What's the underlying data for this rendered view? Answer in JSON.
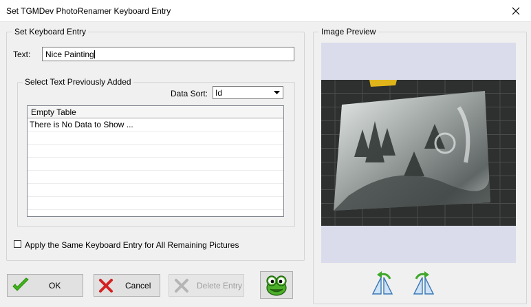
{
  "window": {
    "title": "Set TGMDev PhotoRenamer Keyboard Entry",
    "close_icon": "close-icon"
  },
  "entry_group": {
    "legend": "Set Keyboard Entry",
    "text_label": "Text:",
    "text_value": "Nice Painting"
  },
  "previous_group": {
    "legend": "Select Text Previously Added",
    "sort_label": "Data Sort:",
    "sort_value": "Id",
    "table": {
      "column_header": "Empty Table",
      "rows": [
        "There is No Data to Show ..."
      ]
    }
  },
  "apply_all": {
    "label": "Apply the Same Keyboard Entry for All Remaining Pictures",
    "checked": false
  },
  "buttons": {
    "ok": "OK",
    "cancel": "Cancel",
    "delete": "Delete Entry"
  },
  "preview": {
    "legend": "Image Preview",
    "rotate_left_icon": "rotate-left-icon",
    "rotate_right_icon": "rotate-right-icon"
  },
  "colors": {
    "preview_background": "#dadcec",
    "ok_check": "#3fb618",
    "cancel_x": "#d42020",
    "rotate_arrow": "#3fa82a"
  }
}
